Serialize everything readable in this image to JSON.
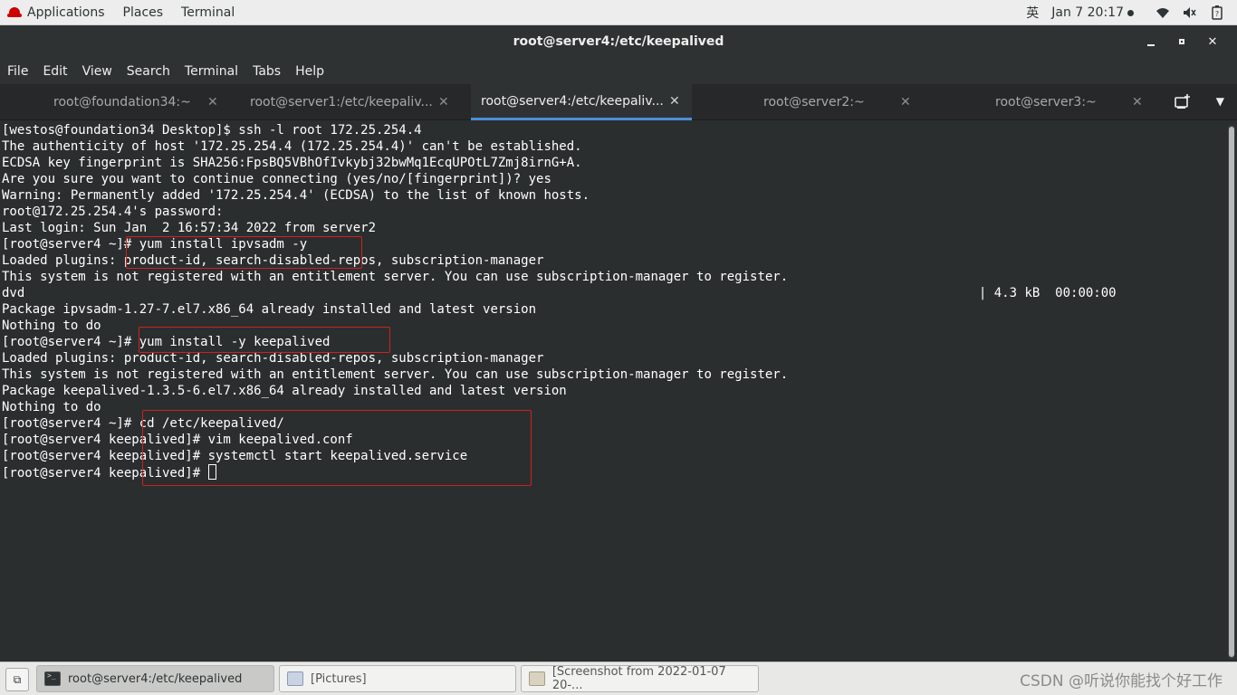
{
  "topbar": {
    "applications": "Applications",
    "places": "Places",
    "terminal": "Terminal",
    "input_method": "英",
    "datetime": "Jan 7  20:17",
    "tray_icons": [
      "wifi-icon",
      "volume-icon",
      "battery-icon"
    ]
  },
  "window": {
    "title": "root@server4:/etc/keepalived"
  },
  "menubar": [
    "File",
    "Edit",
    "View",
    "Search",
    "Terminal",
    "Tabs",
    "Help"
  ],
  "tabs": [
    {
      "label": "root@foundation34:~",
      "active": false
    },
    {
      "label": "root@server1:/etc/keepaliv...",
      "active": false
    },
    {
      "label": "root@server4:/etc/keepaliv...",
      "active": true
    },
    {
      "label": "root@server2:~",
      "active": false
    },
    {
      "label": "root@server3:~",
      "active": false
    }
  ],
  "terminal": {
    "lines": [
      "[westos@foundation34 Desktop]$ ssh -l root 172.25.254.4",
      "The authenticity of host '172.25.254.4 (172.25.254.4)' can't be established.",
      "ECDSA key fingerprint is SHA256:FpsBQ5VBhOfIvkybj32bwMq1EcqUPOtL7Zmj8irnG+A.",
      "Are you sure you want to continue connecting (yes/no/[fingerprint])? yes",
      "Warning: Permanently added '172.25.254.4' (ECDSA) to the list of known hosts.",
      "root@172.25.254.4's password:",
      "Last login: Sun Jan  2 16:57:34 2022 from server2",
      "[root@server4 ~]# yum install ipvsadm -y",
      "Loaded plugins: product-id, search-disabled-repos, subscription-manager",
      "This system is not registered with an entitlement server. You can use subscription-manager to register.",
      "dvd                                                                                                                             | 4.3 kB  00:00:00",
      "Package ipvsadm-1.27-7.el7.x86_64 already installed and latest version",
      "Nothing to do",
      "[root@server4 ~]# yum install -y keepalived",
      "Loaded plugins: product-id, search-disabled-repos, subscription-manager",
      "This system is not registered with an entitlement server. You can use subscription-manager to register.",
      "Package keepalived-1.3.5-6.el7.x86_64 already installed and latest version",
      "Nothing to do",
      "[root@server4 ~]# cd /etc/keepalived/",
      "[root@server4 keepalived]# vim keepalived.conf",
      "[root@server4 keepalived]# systemctl start keepalived.service",
      "[root@server4 keepalived]# "
    ],
    "highlight_color": "#d0201e"
  },
  "taskbar": {
    "items": [
      {
        "label": "root@server4:/etc/keepalived",
        "icon": "terminal-icon",
        "active": true
      },
      {
        "label": "[Pictures]",
        "icon": "folder-icon",
        "active": false
      },
      {
        "label": "[Screenshot from 2022-01-07 20-...",
        "icon": "screenshot-icon",
        "active": false
      }
    ],
    "watermark": "CSDN @听说你能找个好工作"
  }
}
